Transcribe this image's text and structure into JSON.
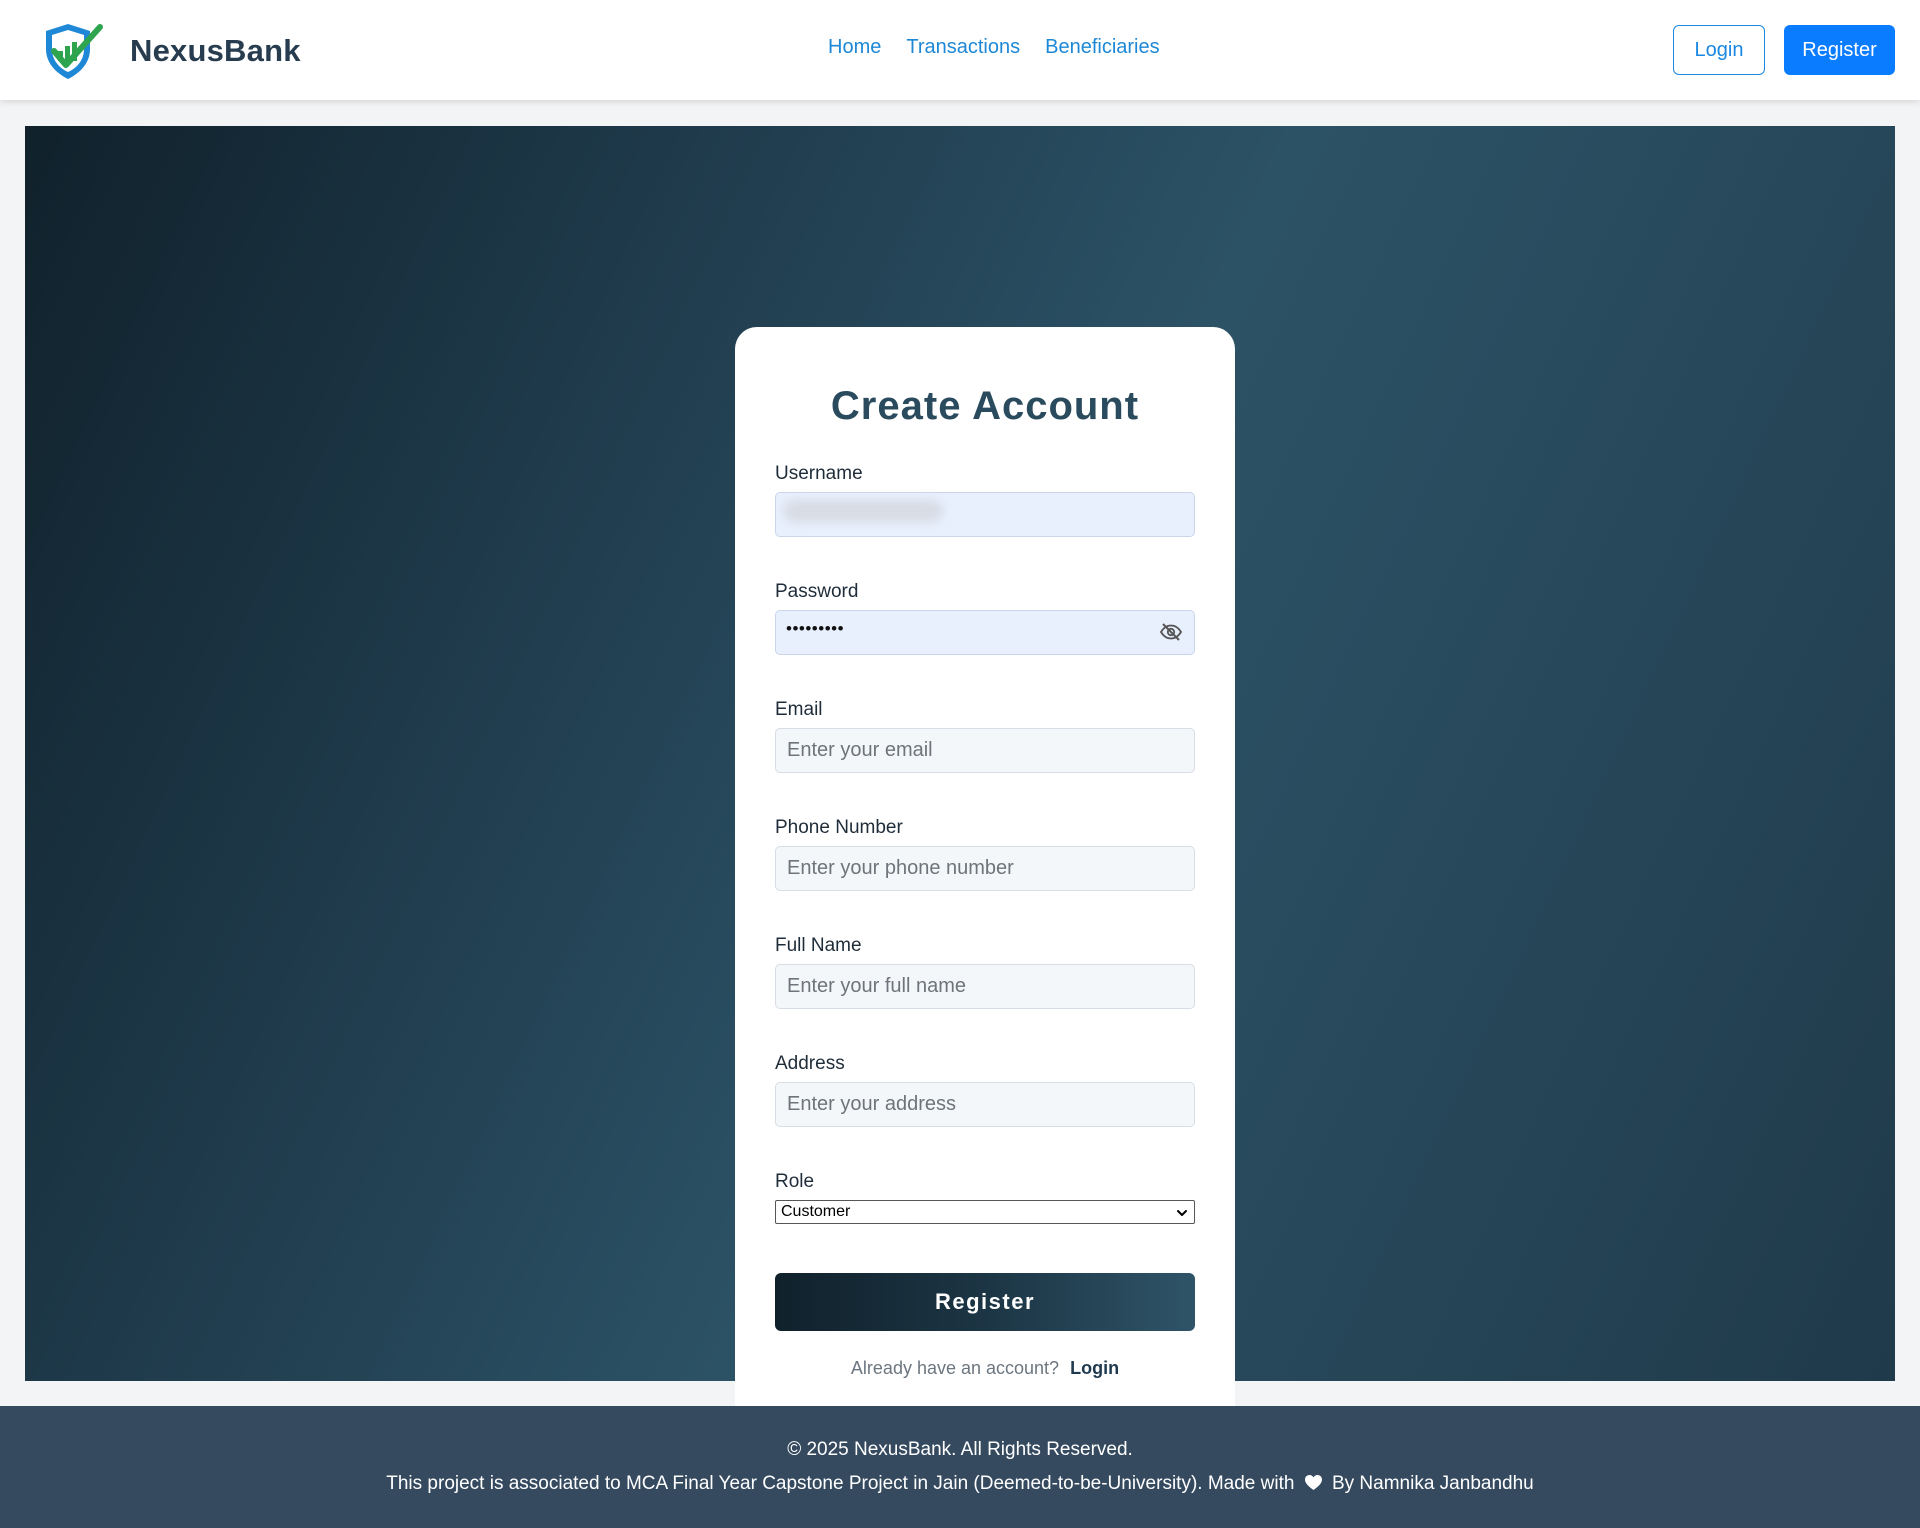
{
  "brand": {
    "name": "NexusBank",
    "logo_icon": "shield-check-logo"
  },
  "nav": {
    "links": [
      "Home",
      "Transactions",
      "Beneficiaries"
    ],
    "login_label": "Login",
    "register_label": "Register"
  },
  "form": {
    "title": "Create Account",
    "username": {
      "label": "Username",
      "value": "",
      "autofilled": true
    },
    "password": {
      "label": "Password",
      "masked_value": "•••••••••",
      "toggle_icon": "eye-off-icon"
    },
    "email": {
      "label": "Email",
      "placeholder": "Enter your email"
    },
    "phone": {
      "label": "Phone Number",
      "placeholder": "Enter your phone number"
    },
    "full_name": {
      "label": "Full Name",
      "placeholder": "Enter your full name"
    },
    "address": {
      "label": "Address",
      "placeholder": "Enter your address"
    },
    "role": {
      "label": "Role",
      "selected": "Customer"
    },
    "submit_label": "Register",
    "switch_prompt": "Already have an account?",
    "switch_link": "Login"
  },
  "footer": {
    "copyright": "© 2025 NexusBank. All Rights Reserved.",
    "credit_prefix": "This project is associated to MCA Final Year Capstone Project in Jain (Deemed-to-be-University). Made with",
    "credit_suffix": "By Namnika Janbandhu"
  },
  "colors": {
    "primary_blue": "#0a7cff",
    "brand_text": "#283c50",
    "hero_dark": "#10212b",
    "hero_mid": "#2c5266",
    "footer_bg": "#354a5f"
  }
}
